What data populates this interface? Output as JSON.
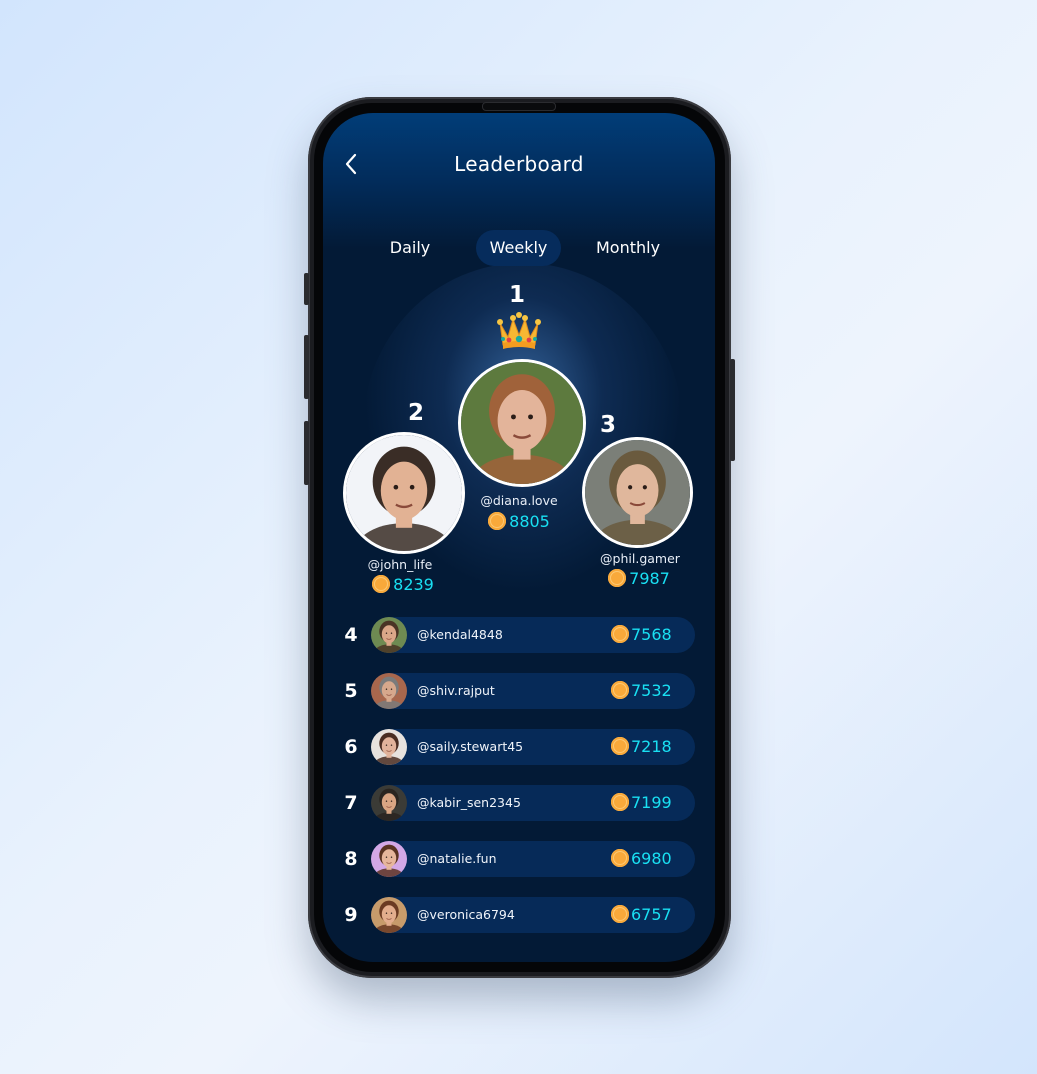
{
  "header": {
    "title": "Leaderboard",
    "back_icon": "chevron-left-icon"
  },
  "tabs": [
    {
      "label": "Daily",
      "active": false
    },
    {
      "label": "Weekly",
      "active": true
    },
    {
      "label": "Monthly",
      "active": false
    }
  ],
  "podium": {
    "first": {
      "rank": "1",
      "handle": "@diana.love",
      "score": "8805",
      "badge_icon": "crown-icon",
      "avatar_colors": [
        "#5d7a3e",
        "#a0623a",
        "#e3b49a"
      ]
    },
    "second": {
      "rank": "2",
      "handle": "@john_life",
      "score": "8239",
      "avatar_colors": [
        "#f2f4f8",
        "#3a2d26",
        "#e2b294"
      ]
    },
    "third": {
      "rank": "3",
      "handle": "@phil.gamer",
      "score": "7987",
      "avatar_colors": [
        "#7b7f78",
        "#6a5a3e",
        "#e0b79c"
      ]
    }
  },
  "list": [
    {
      "rank": "4",
      "handle": "@kendal4848",
      "score": "7568",
      "avatar_colors": [
        "#6e8a52",
        "#4a3425",
        "#dba788"
      ]
    },
    {
      "rank": "5",
      "handle": "@shiv.rajput",
      "score": "7532",
      "avatar_colors": [
        "#a8674d",
        "#7b7b7b",
        "#d7a88c"
      ]
    },
    {
      "rank": "6",
      "handle": "@saily.stewart45",
      "score": "7218",
      "avatar_colors": [
        "#e7e2de",
        "#4a2d22",
        "#e2b39b"
      ]
    },
    {
      "rank": "7",
      "handle": "@kabir_sen2345",
      "score": "7199",
      "avatar_colors": [
        "#3b3b36",
        "#2a2520",
        "#d9a583"
      ]
    },
    {
      "rank": "8",
      "handle": "@natalie.fun",
      "score": "6980",
      "avatar_colors": [
        "#d3a8e6",
        "#5a3322",
        "#e6b69c"
      ]
    },
    {
      "rank": "9",
      "handle": "@veronica6794",
      "score": "6757",
      "avatar_colors": [
        "#c79b6b",
        "#6b3a22",
        "#e3ad8d"
      ]
    }
  ],
  "colors": {
    "accent_score": "#19e0f3",
    "coin": "#f9a93a",
    "active_tab": "#062c5c",
    "row_bg": "#062a58",
    "screen_bg": "#031a36"
  },
  "icons": {
    "coin": "coin-icon"
  }
}
